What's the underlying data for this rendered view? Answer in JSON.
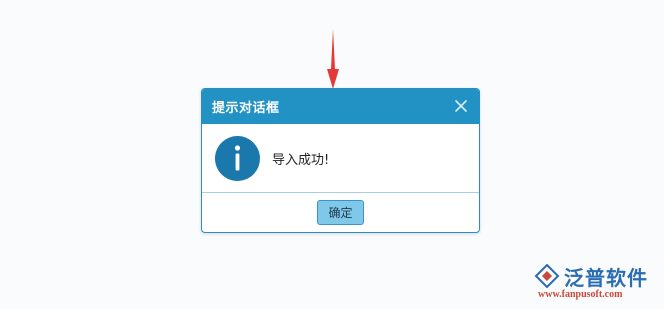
{
  "dialog": {
    "title": "提示对话框",
    "message": "导入成功!",
    "ok_label": "确定",
    "close_icon": "close-icon",
    "info_icon": "info-icon"
  },
  "logo": {
    "brand": "泛普软件",
    "url": "www.fanpusoft.com"
  },
  "colors": {
    "header": "#2292c4",
    "info_icon": "#1a78ad",
    "ok_button": "#7fc8ea",
    "arrow": "#e53935"
  }
}
